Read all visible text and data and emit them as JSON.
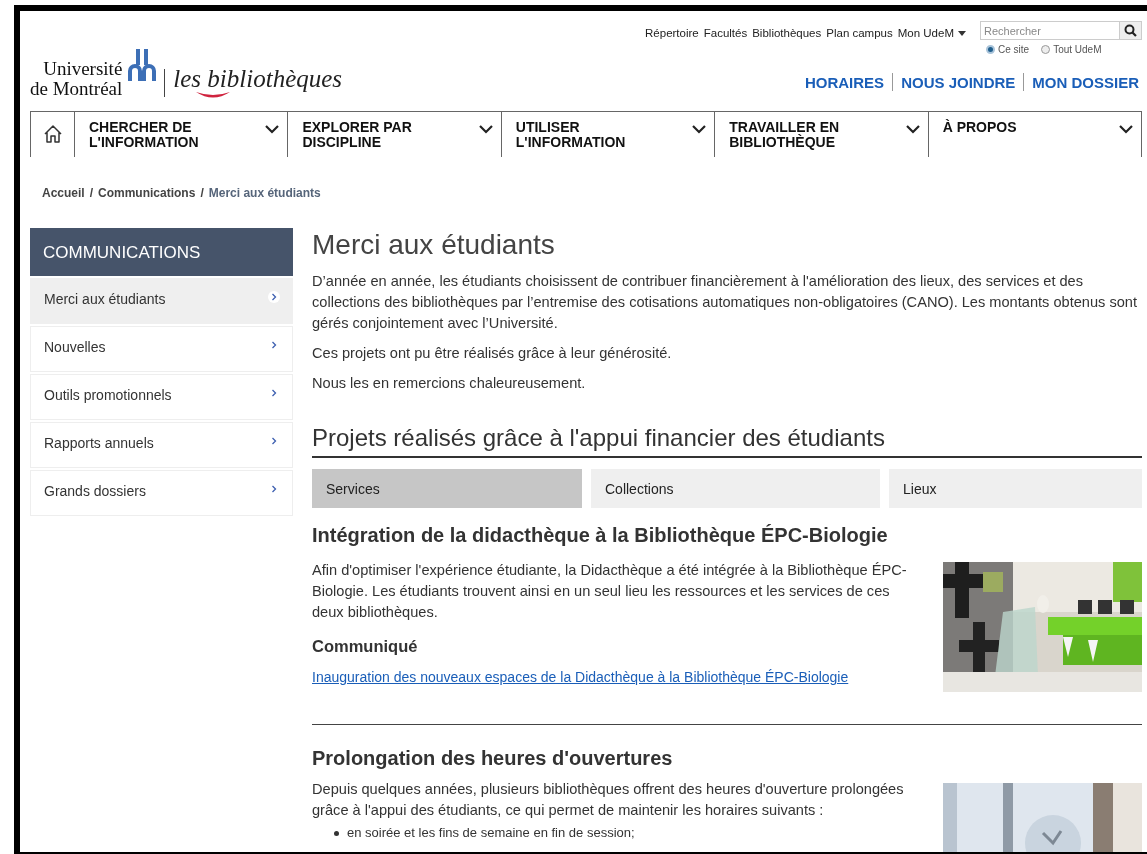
{
  "utility_links": [
    {
      "label": "Répertoire",
      "kind": "link"
    },
    {
      "label": "Facultés",
      "kind": "link"
    },
    {
      "label": "Bibliothèques",
      "kind": "link"
    },
    {
      "label": "Plan campus",
      "kind": "link"
    },
    {
      "label": "Mon UdeM",
      "kind": "dropdown"
    }
  ],
  "search": {
    "placeholder": "Rechercher",
    "scopes": [
      {
        "label": "Ce site",
        "selected": true
      },
      {
        "label": "Tout UdeM",
        "selected": false
      }
    ]
  },
  "logo": {
    "university": [
      "Université",
      "de Montréal"
    ],
    "subtitle": "les bibliothèques"
  },
  "quick_links": [
    "HORAIRES",
    "NOUS JOINDRE",
    "MON DOSSIER"
  ],
  "nav": [
    {
      "label": "CHERCHER DE L'INFORMATION"
    },
    {
      "label": "EXPLORER PAR DISCIPLINE"
    },
    {
      "label": "UTILISER L'INFORMATION"
    },
    {
      "label": "TRAVAILLER EN BIBLIOTHÈQUE"
    },
    {
      "label": "À PROPOS"
    }
  ],
  "breadcrumb": {
    "separator": "/",
    "items": [
      {
        "label": "Accueil",
        "current": false
      },
      {
        "label": "Communications",
        "current": false
      },
      {
        "label": "Merci aux étudiants",
        "current": true
      }
    ]
  },
  "sidebar": {
    "title": "COMMUNICATIONS",
    "items": [
      {
        "label": "Merci aux étudiants",
        "selected": true
      },
      {
        "label": "Nouvelles",
        "selected": false
      },
      {
        "label": "Outils promotionnels",
        "selected": false
      },
      {
        "label": "Rapports annuels",
        "selected": false
      },
      {
        "label": "Grands dossiers",
        "selected": false
      }
    ]
  },
  "main": {
    "title": "Merci aux étudiants",
    "intro": [
      "D’année en année, les étudiants choisissent de contribuer financièrement à l'amélioration des lieux, des services et des collections des bibliothèques par l’entremise des cotisations automatiques non-obligatoires (CANO). Les montants obtenus sont gérés conjointement avec l’Université.",
      "Ces projets ont pu être réalisés grâce à leur générosité.",
      "Nous les en remercions chaleureusement."
    ],
    "section_title": "Projets réalisés grâce à l'appui financier des étudiants",
    "tabs": [
      {
        "label": "Services",
        "selected": true
      },
      {
        "label": "Collections",
        "selected": false
      },
      {
        "label": "Lieux",
        "selected": false
      }
    ],
    "articles": [
      {
        "title": "Intégration de la didacthèque à la Bibliothèque ÉPC-Biologie",
        "body": "Afin d'optimiser l'expérience étudiante, la Didacthèque a été intégrée à la Bibliothèque ÉPC-Biologie. Les étudiants trouvent ainsi en un seul lieu les ressources et les services de ces deux bibliothèques.",
        "subheading": "Communiqué",
        "link": "Inauguration des nouveaux espaces de la Didacthèque à la Bibliothèque ÉPC-Biologie",
        "image": {
          "kind": "picture"
        }
      },
      {
        "title": "Prolongation des heures d'ouvertures",
        "body": "Depuis quelques années, plusieurs bibliothèques offrent des heures d'ouverture prolongées grâce à l'appui des étudiants, ce qui permet de maintenir les horaires suivants :",
        "bullets": [
          "en soirée et les fins de semaine en fin de session;"
        ],
        "image": {
          "kind": "picture"
        }
      }
    ]
  }
}
